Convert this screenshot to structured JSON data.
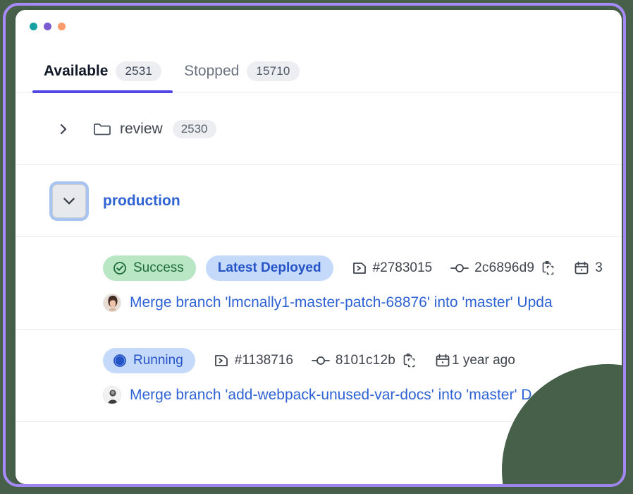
{
  "window": {
    "traffic_lights": [
      {
        "name": "close-dot",
        "color": "#17a2a2"
      },
      {
        "name": "minimize-dot",
        "color": "#7c5bd1"
      },
      {
        "name": "maximize-dot",
        "color": "#fb9a6b"
      }
    ],
    "frame_accent": "#a78bfa",
    "background": "#47604a"
  },
  "tabs": {
    "active_index": 0,
    "accent": "#4f46e5",
    "items": [
      {
        "label": "Available",
        "count": "2531"
      },
      {
        "label": "Stopped",
        "count": "15710"
      }
    ]
  },
  "groups": [
    {
      "name": "review",
      "count": "2530",
      "expanded": false,
      "icon": "folder-icon",
      "chevron": "chevron-right-icon",
      "is_link": false
    },
    {
      "name": "production",
      "count": "",
      "expanded": true,
      "icon": "",
      "chevron": "chevron-down-icon",
      "is_link": true,
      "focused": true
    }
  ],
  "deployments": [
    {
      "status": {
        "label": "Success",
        "icon": "check-circle-icon",
        "style": "success"
      },
      "tag": "Latest Deployed",
      "pipeline": {
        "icon": "pipeline-icon",
        "label": "#2783015"
      },
      "commit": {
        "icon": "commit-icon",
        "sha": "2c6896d9",
        "copy_icon": "copy-icon"
      },
      "date": {
        "icon": "calendar-icon",
        "label": "3"
      },
      "author_avatar": "avatar-photo-woman",
      "title": "Merge branch 'lmcnally1-master-patch-68876' into 'master' Upda"
    },
    {
      "status": {
        "label": "Running",
        "icon": "running-icon",
        "style": "running"
      },
      "tag": "",
      "pipeline": {
        "icon": "pipeline-icon",
        "label": "#1138716"
      },
      "commit": {
        "icon": "commit-icon",
        "sha": "8101c12b",
        "copy_icon": "copy-icon"
      },
      "date": {
        "icon": "calendar-icon",
        "label": "1 year ago"
      },
      "author_avatar": "avatar-photo-person",
      "title": "Merge branch 'add-webpack-unused-var-docs' into 'master' D"
    }
  ]
}
